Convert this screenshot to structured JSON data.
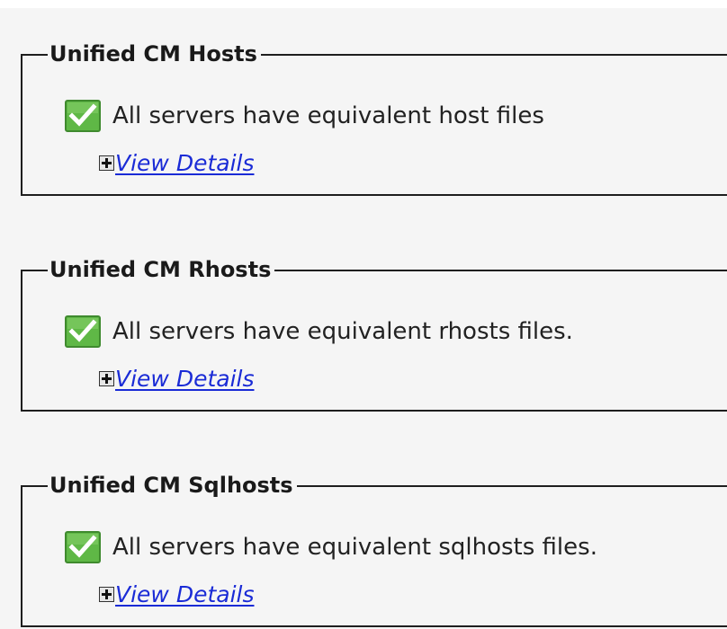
{
  "sections": [
    {
      "title": "Unified CM Hosts",
      "status_icon": "checkmark-icon",
      "status_text": "All servers have equivalent host files",
      "details_icon": "expand-plus-icon",
      "details_link": "View Details"
    },
    {
      "title": "Unified CM Rhosts",
      "status_icon": "checkmark-icon",
      "status_text": "All servers have equivalent rhosts files.",
      "details_icon": "expand-plus-icon",
      "details_link": "View Details"
    },
    {
      "title": "Unified CM Sqlhosts",
      "status_icon": "checkmark-icon",
      "status_text": "All servers have equivalent sqlhosts files.",
      "details_icon": "expand-plus-icon",
      "details_link": "View Details"
    }
  ],
  "colors": {
    "background": "#f5f5f5",
    "border": "#1e1e1e",
    "link": "#1a2bd6",
    "check_fill": "#5fb846",
    "check_mark": "#ffffff"
  }
}
